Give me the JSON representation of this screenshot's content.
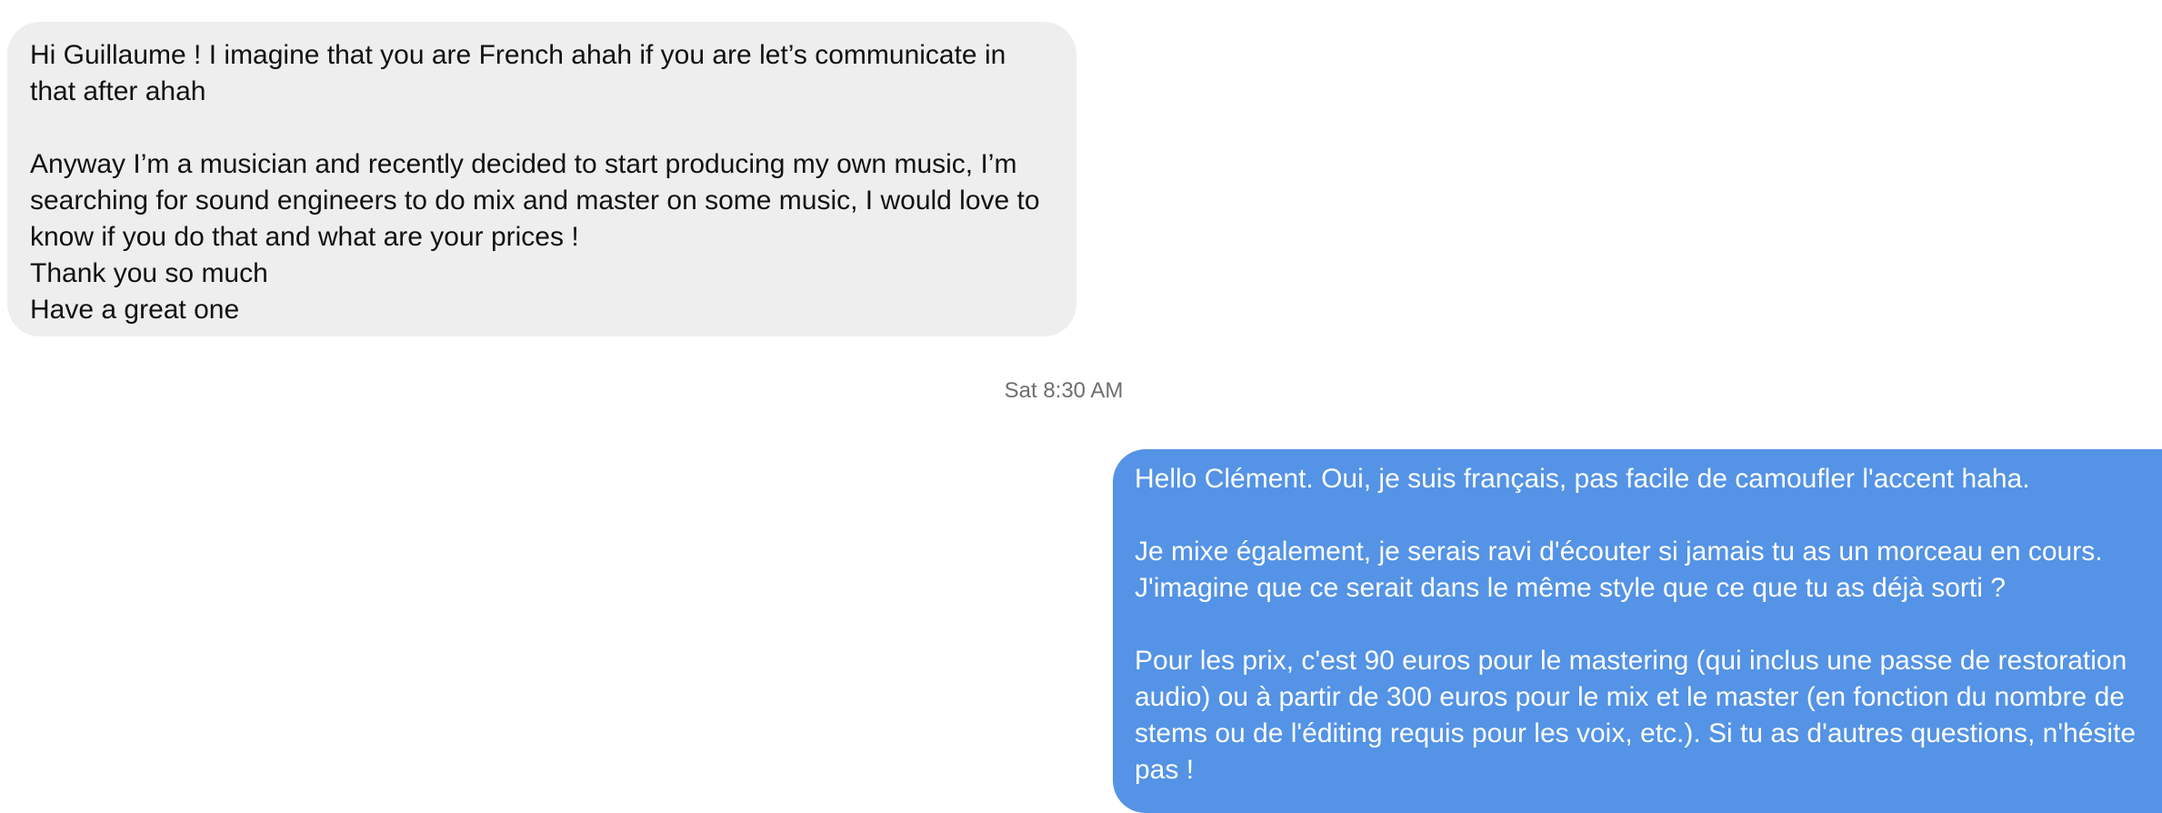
{
  "conversation": {
    "incoming_message": "Hi Guillaume ! I imagine that you are French ahah if you are let’s communicate in that after ahah\n\nAnyway I’m a musician and recently decided to start producing my own music, I’m searching for sound engineers to do mix and master on some music, I would love to know if you do that and what are your prices !\nThank you so much\nHave a great one",
    "timestamp": "Sat 8:30 AM",
    "outgoing_message": "Hello Clément. Oui, je suis français, pas facile de camoufler l'accent haha.\n\nJe mixe également, je serais ravi d'écouter si jamais tu as un morceau en cours. J'imagine que ce serait dans le même style que ce que tu as déjà sorti ?\n\nPour les prix, c'est 90 euros pour le mastering (qui inclus une passe de restoration audio) ou à partir de 300 euros pour le mix et le master (en fonction du nombre de stems ou de l'éditing requis pour les voix, etc.). Si tu as d'autres questions, n'hésite pas !"
  },
  "colors": {
    "incoming_bubble": "#eeeeee",
    "outgoing_bubble": "#5493e5",
    "timestamp_text": "#6f6f6f"
  }
}
